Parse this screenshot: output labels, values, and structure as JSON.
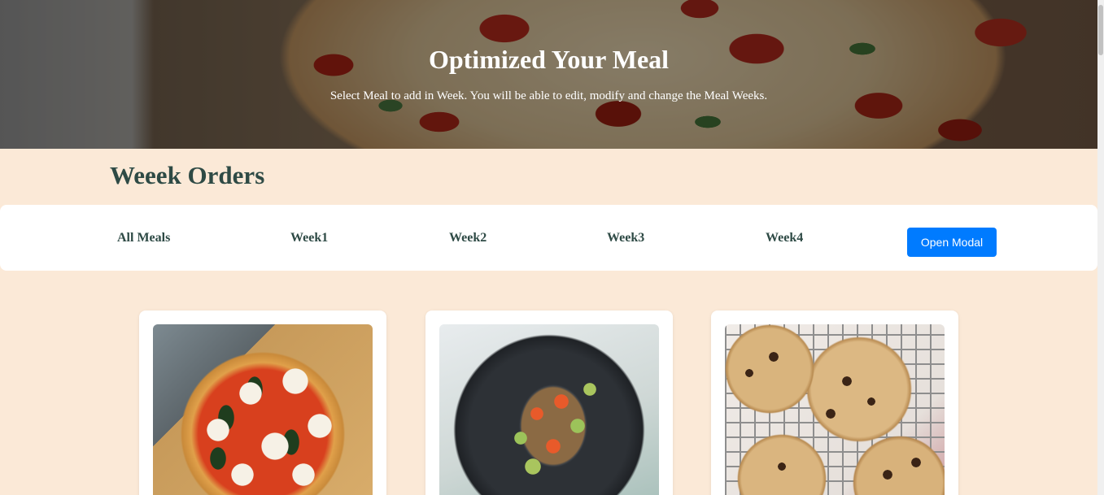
{
  "hero": {
    "title": "Optimized Your Meal",
    "subtitle": "Select Meal to add in Week. You will be able to edit, modify and change the Meal Weeks."
  },
  "section": {
    "title": "Weeek Orders"
  },
  "tabs": [
    {
      "label": "All Meals"
    },
    {
      "label": "Week1"
    },
    {
      "label": "Week2"
    },
    {
      "label": "Week3"
    },
    {
      "label": "Week4"
    }
  ],
  "actions": {
    "open_modal_label": "Open Modal",
    "open_modal_color": "#007bff"
  },
  "cards": [
    {
      "image": "margherita-pizza"
    },
    {
      "image": "vegetable-bowl"
    },
    {
      "image": "chocolate-chip-cookies"
    }
  ],
  "colors": {
    "background": "#fbe9d7",
    "heading": "#2e4a45",
    "panel": "#ffffff"
  }
}
